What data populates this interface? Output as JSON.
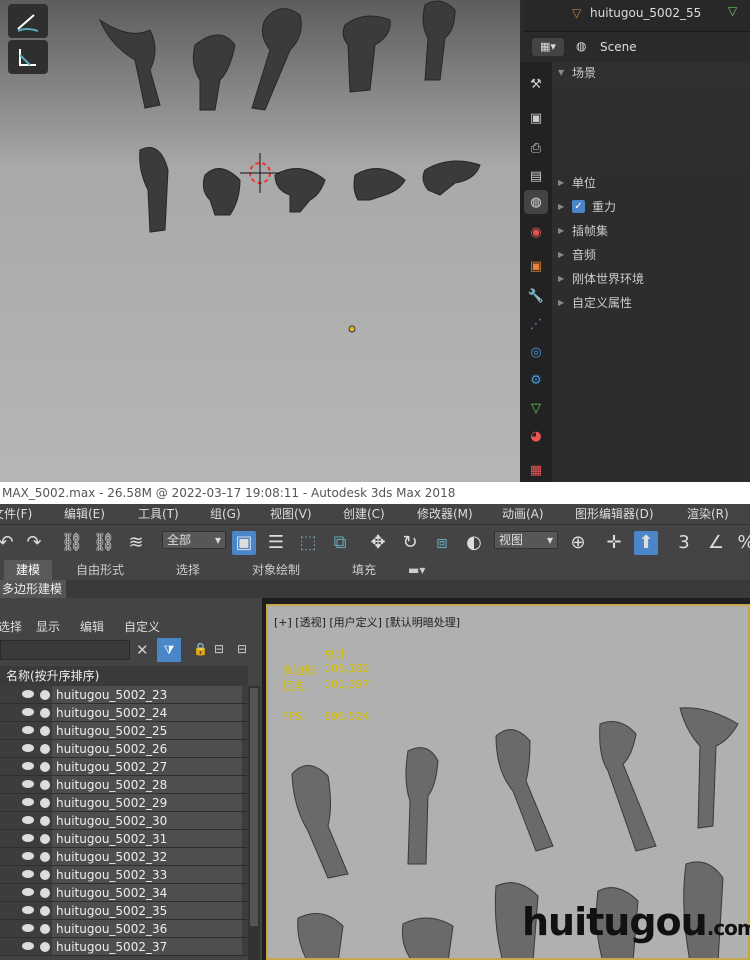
{
  "blender": {
    "outliner_item": "huitugou_5002_55",
    "scene_name": "Scene",
    "panels": [
      "场景",
      "单位",
      "重力",
      "插帧集",
      "音频",
      "刚体世界环境",
      "自定义属性"
    ]
  },
  "max": {
    "title": "MAX_5002.max - 26.58M @ 2022-03-17 19:08:11 - Autodesk 3ds Max 2018",
    "menu": [
      "文件(F)",
      "编辑(E)",
      "工具(T)",
      "组(G)",
      "视图(V)",
      "创建(C)",
      "修改器(M)",
      "动画(A)",
      "图形编辑器(D)",
      "渲染(R)"
    ],
    "select_filter": "全部",
    "view_dropdown": "视图",
    "ribbon_tabs": [
      "建模",
      "自由形式",
      "选择",
      "对象绘制",
      "填充"
    ],
    "subribbon": "多边形建模",
    "scene_menu": [
      "选择",
      "显示",
      "编辑",
      "自定义"
    ],
    "column_header": "名称(按升序排序)",
    "objects": [
      "huitugou_5002_23",
      "huitugou_5002_24",
      "huitugou_5002_25",
      "huitugou_5002_26",
      "huitugou_5002_27",
      "huitugou_5002_28",
      "huitugou_5002_29",
      "huitugou_5002_30",
      "huitugou_5002_31",
      "huitugou_5002_32",
      "huitugou_5002_33",
      "huitugou_5002_34",
      "huitugou_5002_35",
      "huitugou_5002_36",
      "huitugou_5002_37"
    ],
    "viewport_label": "[+] [透视] [用户定义] [默认明暗处理]",
    "stats": {
      "total_label": "总计",
      "poly_label": "多边形:",
      "poly": "106,182",
      "vert_label": "顶点:",
      "vert": "101,397",
      "fps_label": "FPS:",
      "fps": "696.524"
    }
  },
  "watermark": {
    "main": "huitugou",
    "suffix": ".com"
  }
}
